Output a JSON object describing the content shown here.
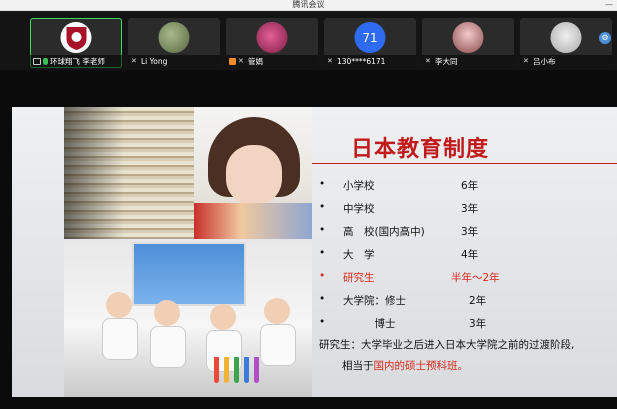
{
  "app": {
    "window_title": "腾讯会议"
  },
  "participants": [
    {
      "name": "环球翔飞 李老师",
      "avatar_text": "",
      "avatar_color": "#ffffff",
      "active": true,
      "mic": "on"
    },
    {
      "name": "Li Yong",
      "avatar_text": "",
      "avatar_color": "#7a8a6a",
      "active": false,
      "mic": "off"
    },
    {
      "name": "管娟",
      "avatar_text": "",
      "avatar_color": "#b7356b",
      "active": false,
      "mic": "off"
    },
    {
      "name": "130****6171",
      "avatar_text": "71",
      "avatar_color": "#2f6bf0",
      "active": false,
      "mic": "off"
    },
    {
      "name": "李大同",
      "avatar_text": "",
      "avatar_color": "#d9a6a6",
      "active": false,
      "mic": "off"
    },
    {
      "name": "吕小布",
      "avatar_text": "",
      "avatar_color": "#c8c8c8",
      "active": false,
      "mic": "off"
    }
  ],
  "slide": {
    "title": "日本教育制度",
    "items": [
      {
        "bullet": "•",
        "label": "小学校",
        "value": "6年"
      },
      {
        "bullet": "•",
        "label": "中学校",
        "value": "3年"
      },
      {
        "bullet": "•",
        "label": "高　校(国内高中)",
        "value": "3年"
      },
      {
        "bullet": "•",
        "label": "大　学",
        "value": "4年"
      },
      {
        "bullet": "•",
        "label": "研究生",
        "value": "半年～2年",
        "highlight": true
      },
      {
        "bullet": "•",
        "label": "大学院：修士",
        "value": "2年"
      },
      {
        "bullet": "•",
        "label": "　　　博士",
        "value": "3年"
      }
    ],
    "note_line1": "研究生：大学毕业之后进入日本大学院之前的过渡阶段,",
    "note_line2_prefix": "相当于",
    "note_line2_highlight": "国内的硕士预科班。",
    "colors": {
      "title": "#c21a1a",
      "highlight": "#d9281b"
    }
  }
}
